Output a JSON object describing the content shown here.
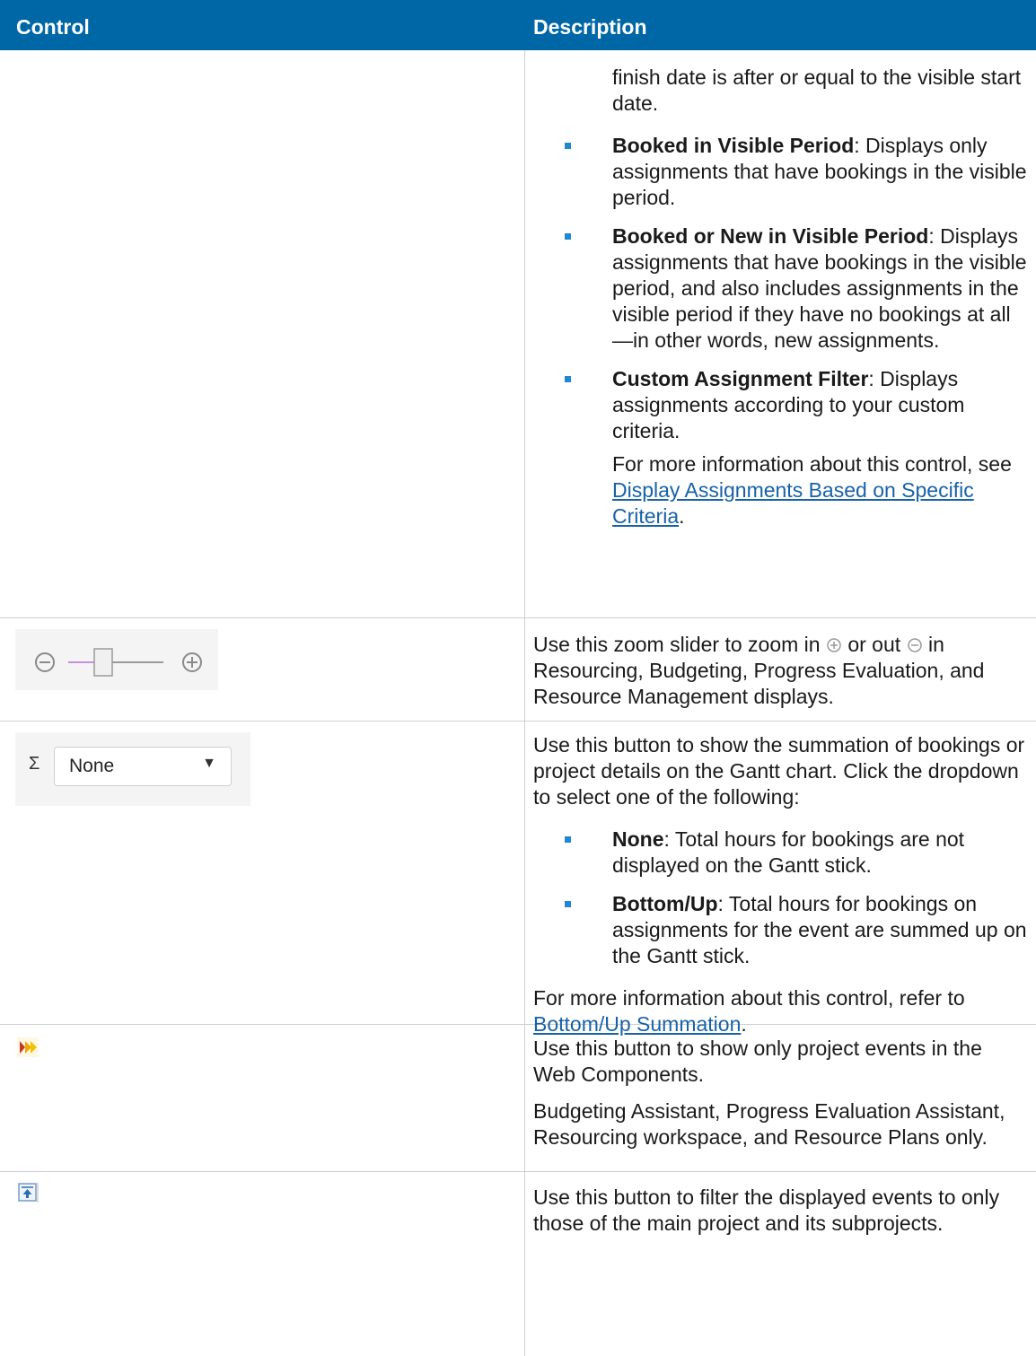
{
  "table": {
    "headers": {
      "control": "Control",
      "description": "Description"
    }
  },
  "rows": [
    {
      "continuation": "finish date is after or equal to the visible start date.",
      "bullets": [
        {
          "term": "Booked in Visible Period",
          "text": ": Displays only assignments that have bookings in the visible period."
        },
        {
          "term": "Booked or New in Visible Period",
          "text": ": Displays assignments that have bookings in the visible period, and also includes assignments in the visible period if they have no bookings at all—in other words, new assignments."
        },
        {
          "term": "Custom Assignment Filter",
          "text": ": Displays assignments according to your custom criteria."
        }
      ],
      "more_info_prefix": "For more information about this control, see ",
      "more_info_link": "Display Assignments Based on Specific Criteria",
      "more_info_suffix": "."
    },
    {
      "desc_pre": "Use this zoom slider to zoom in ",
      "desc_mid": " or out ",
      "desc_post": " in Resourcing, Budgeting, Progress Evaluation, and Resource Management displays.",
      "slider_level": 0.3
    },
    {
      "control_sigma": "Σ",
      "control_select_value": "None",
      "intro": "Use this button to show the summation of bookings or project details on the Gantt chart. Click the dropdown to select one of the following:",
      "bullets": [
        {
          "term": "None",
          "text": ": Total hours for bookings are not displayed on the Gantt stick."
        },
        {
          "term": "Bottom/Up",
          "text": ": Total hours for bookings on assignments for the event are summed up on the Gantt stick."
        }
      ],
      "more_info_prefix": "For more information about this control, refer to ",
      "more_info_link": "Bottom/Up Summation",
      "more_info_suffix": "."
    },
    {
      "p1": "Use this button to show only project events in the Web Components.",
      "p2": "Budgeting Assistant, Progress Evaluation Assistant, Resourcing workspace, and Resource Plans only."
    },
    {
      "p1": "Use this button to filter the displayed events to only those of the main project and its subprojects."
    }
  ],
  "colors": {
    "header_bg": "#0067a6",
    "bullet": "#1e88d0",
    "link": "#1762a8"
  }
}
